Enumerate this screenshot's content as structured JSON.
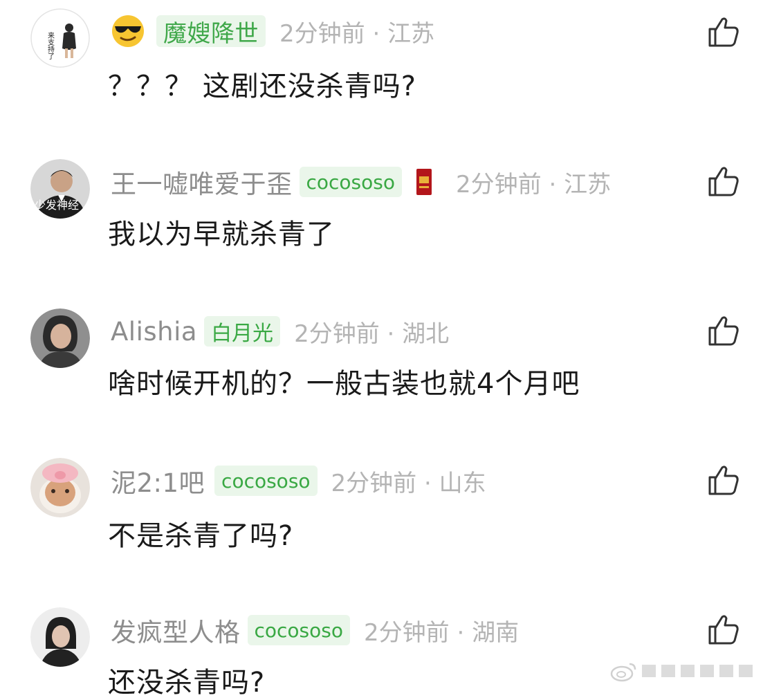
{
  "comments": [
    {
      "username": "魔嫂降世",
      "badge": "",
      "time": "2分钟前",
      "location": "江苏",
      "text": "？？？ 这剧还没杀青吗?",
      "avatar_text": "来支持了"
    },
    {
      "username": "王一嘘唯爱于歪",
      "badge": "cocososo",
      "time": "2分钟前",
      "location": "江苏",
      "text": "我以为早就杀青了",
      "avatar_text": "少发神经"
    },
    {
      "username": "Alishia",
      "badge": "白月光",
      "time": "2分钟前",
      "location": "湖北",
      "text": "啥时候开机的？一般古装也就4个月吧"
    },
    {
      "username": "泥2:1吧",
      "badge": "cocososo",
      "time": "2分钟前",
      "location": "山东",
      "text": "不是杀青了吗?"
    },
    {
      "username": "发疯型人格",
      "badge": "cocososo",
      "time": "2分钟前",
      "location": "湖南",
      "text": "还没杀青吗?"
    }
  ],
  "separator": " · ",
  "icons": {
    "like": "thumbs-up-icon",
    "emoji": "sunglasses-emoji-icon",
    "watermark": "weibo-logo-icon"
  },
  "colors": {
    "highlight_name": "#40a84a",
    "badge_bg": "#eaf6ea",
    "badge_text": "#39a843",
    "meta_gray": "#b4b4b4",
    "name_gray": "#8d8d8d"
  }
}
